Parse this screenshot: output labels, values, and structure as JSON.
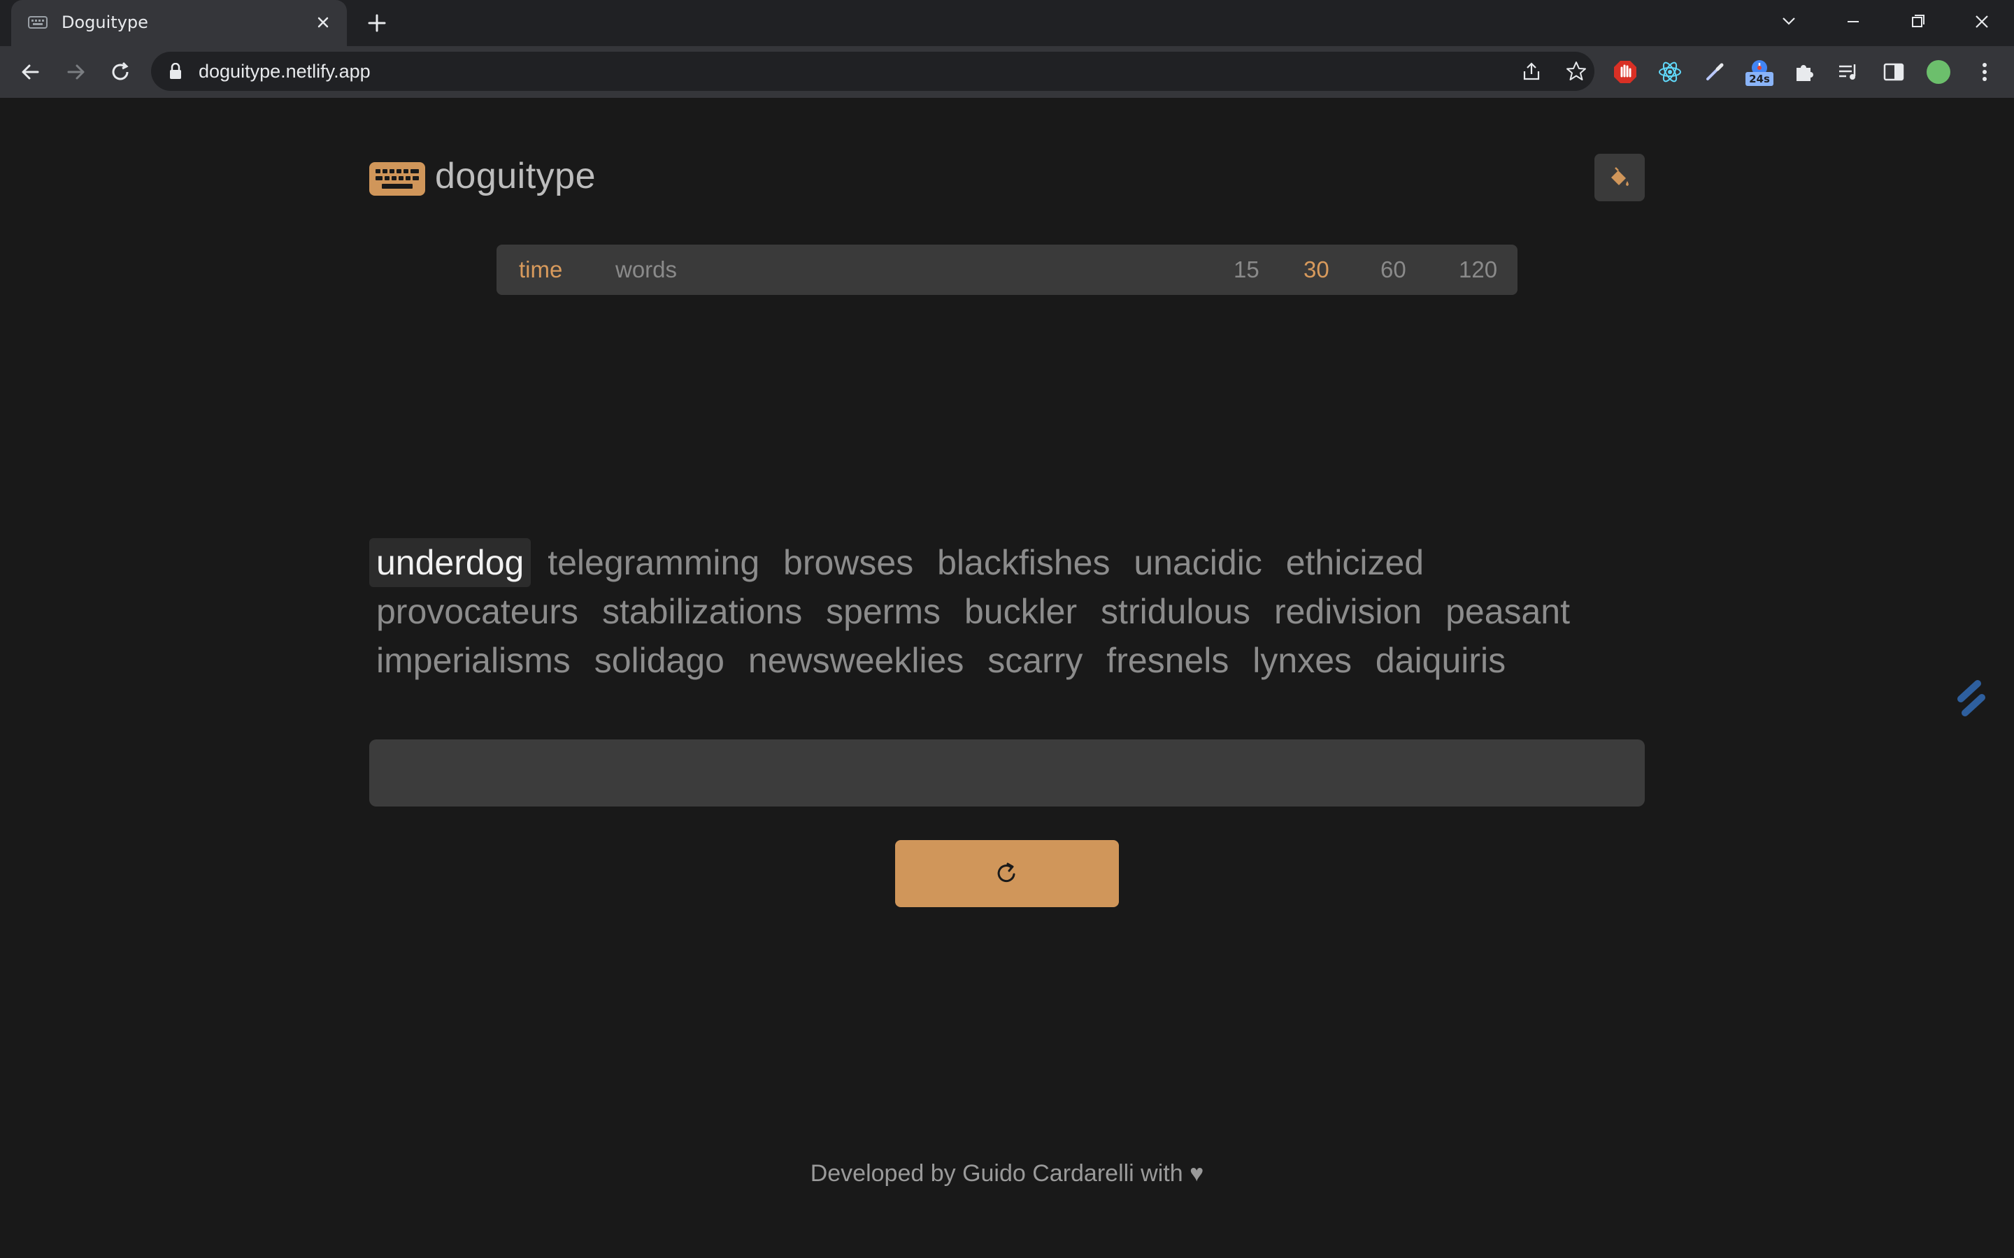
{
  "browser": {
    "tab_title": "Doguitype",
    "url": "doguitype.netlify.app",
    "icons": [
      "keyboard-favicon",
      "close-icon",
      "plus-icon",
      "chevron-down-icon",
      "minimize-icon",
      "restore-icon",
      "close-window-icon",
      "back-arrow-icon",
      "forward-arrow-icon",
      "reload-icon",
      "lock-icon",
      "share-icon",
      "star-icon",
      "adblock-icon",
      "react-devtools-icon",
      "eyedropper-icon",
      "timer-extension-icon",
      "puzzle-extensions-icon",
      "media-queue-icon",
      "side-panel-icon",
      "profile-avatar",
      "kebab-menu-icon"
    ],
    "timer_badge": "24s"
  },
  "app": {
    "name": "doguitype",
    "logo_icon": "keyboard-icon",
    "theme_icon": "paint-bucket-icon",
    "accent_color": "#d0965a"
  },
  "mode_bar": {
    "modes": [
      {
        "label": "time",
        "active": true
      },
      {
        "label": "words",
        "active": false
      }
    ],
    "durations": [
      {
        "label": "15",
        "active": false
      },
      {
        "label": "30",
        "active": true
      },
      {
        "label": "60",
        "active": false
      },
      {
        "label": "120",
        "active": false
      }
    ]
  },
  "words": [
    "underdog",
    "telegramming",
    "browses",
    "blackfishes",
    "unacidic",
    "ethicized",
    "provocateurs",
    "stabilizations",
    "sperms",
    "buckler",
    "stridulous",
    "redivision",
    "peasant",
    "imperialisms",
    "solidago",
    "newsweeklies",
    "scarry",
    "fresnels",
    "lynxes",
    "daiquiris"
  ],
  "current_word_index": 0,
  "input": {
    "value": "",
    "placeholder": ""
  },
  "restart_icon": "restart-icon",
  "footer": {
    "text": "Developed by Guido Cardarelli with ♥"
  }
}
